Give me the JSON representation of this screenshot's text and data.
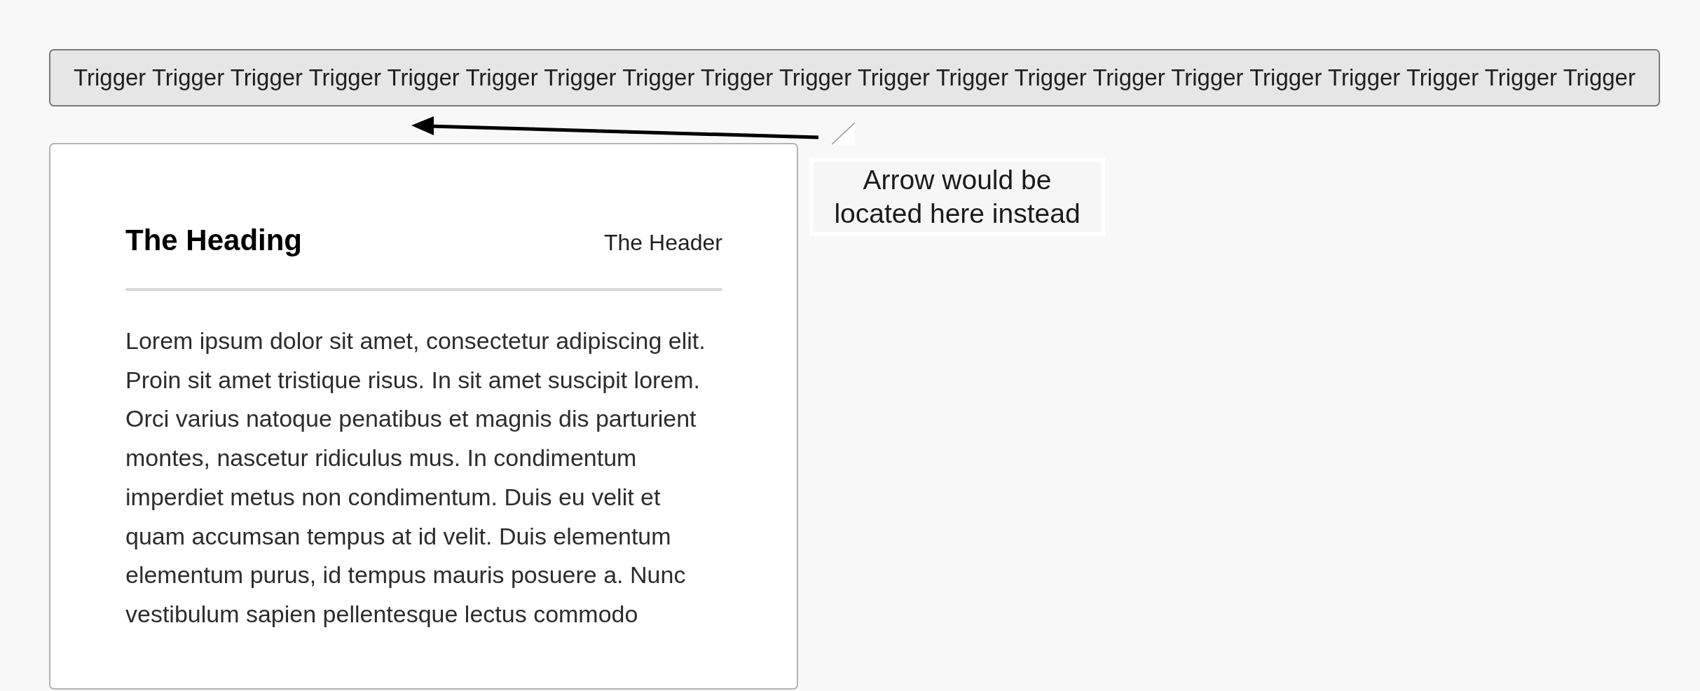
{
  "trigger": {
    "label": "Trigger Trigger Trigger Trigger Trigger Trigger Trigger Trigger Trigger Trigger Trigger Trigger Trigger Trigger Trigger Trigger Trigger Trigger Trigger Trigger"
  },
  "card": {
    "heading": "The Heading",
    "header": "The Header",
    "body_lines": [
      "Lorem ipsum dolor sit amet, consectetur adipiscing elit.",
      "Proin sit amet tristique risus. In sit amet suscipit lorem.",
      "Orci varius natoque penatibus et magnis dis parturient",
      "montes, nascetur ridiculus mus. In condimentum",
      "imperdiet metus non condimentum. Duis eu velit et",
      "quam accumsan tempus at id velit. Duis elementum",
      "elementum purus, id tempus mauris posuere a. Nunc",
      "vestibulum sapien pellentesque lectus commodo"
    ]
  },
  "annotation": {
    "lines": [
      "Arrow would be",
      "located here instead"
    ]
  }
}
